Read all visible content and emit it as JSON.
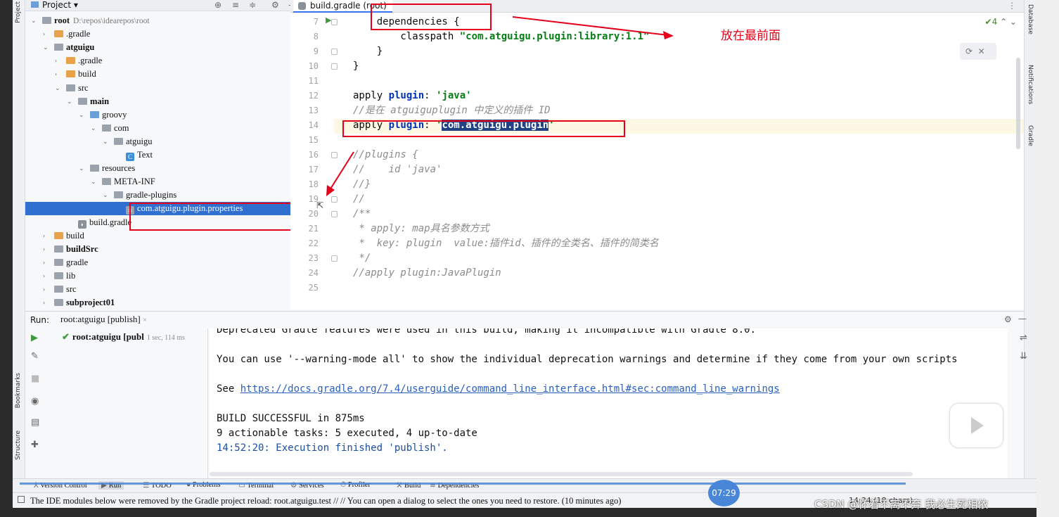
{
  "project": {
    "header_label": "Project",
    "tree": [
      {
        "label": "root",
        "path": "D:\\repos\\idearepos\\root",
        "depth": 0,
        "arrow": "down",
        "icon": "gray",
        "bold": true
      },
      {
        "label": ".gradle",
        "depth": 1,
        "arrow": "right",
        "icon": "orange"
      },
      {
        "label": "atguigu",
        "depth": 1,
        "arrow": "down",
        "icon": "gray",
        "bold": true
      },
      {
        "label": ".gradle",
        "depth": 2,
        "arrow": "right",
        "icon": "orange"
      },
      {
        "label": "build",
        "depth": 2,
        "arrow": "right",
        "icon": "orange"
      },
      {
        "label": "src",
        "depth": 2,
        "arrow": "down",
        "icon": "gray"
      },
      {
        "label": "main",
        "depth": 3,
        "arrow": "down",
        "icon": "gray",
        "bold": true
      },
      {
        "label": "groovy",
        "depth": 4,
        "arrow": "down",
        "icon": "blue"
      },
      {
        "label": "com",
        "depth": 5,
        "arrow": "down",
        "icon": "gray"
      },
      {
        "label": "atguigu",
        "depth": 6,
        "arrow": "down",
        "icon": "gray"
      },
      {
        "label": "Text",
        "depth": 7,
        "arrow": "",
        "icon": "class"
      },
      {
        "label": "resources",
        "depth": 4,
        "arrow": "down",
        "icon": "gray"
      },
      {
        "label": "META-INF",
        "depth": 5,
        "arrow": "down",
        "icon": "gray"
      },
      {
        "label": "gradle-plugins",
        "depth": 6,
        "arrow": "down",
        "icon": "gray"
      },
      {
        "label": "com.atguigu.plugin.properties",
        "depth": 7,
        "arrow": "",
        "icon": "props",
        "selected": true
      },
      {
        "label": "build.gradle",
        "depth": 3,
        "arrow": "",
        "icon": "gradle"
      },
      {
        "label": "build",
        "depth": 1,
        "arrow": "right",
        "icon": "orange"
      },
      {
        "label": "buildSrc",
        "depth": 1,
        "arrow": "right",
        "icon": "gray",
        "bold": true
      },
      {
        "label": "gradle",
        "depth": 1,
        "arrow": "right",
        "icon": "gray"
      },
      {
        "label": "lib",
        "depth": 1,
        "arrow": "right",
        "icon": "gray"
      },
      {
        "label": "src",
        "depth": 1,
        "arrow": "right",
        "icon": "gray"
      },
      {
        "label": "subproject01",
        "depth": 1,
        "arrow": "right",
        "icon": "gray",
        "bold": true
      }
    ]
  },
  "editor": {
    "tab_label": "build.gradle (root)",
    "indicator": "✔4",
    "annotation": "放在最前面",
    "lines": [
      {
        "n": "7",
        "html": "    <span class=\"cls\">dependencies</span> {"
      },
      {
        "n": "8",
        "html": "        classpath <span class=\"str\">\"com.atguigu.plugin:library:1.1\"</span>"
      },
      {
        "n": "9",
        "html": "    }"
      },
      {
        "n": "10",
        "html": "}"
      },
      {
        "n": "11",
        "html": ""
      },
      {
        "n": "12",
        "html": "apply <span class=\"kw\">plugin</span>: <span class=\"str\">'java'</span>"
      },
      {
        "n": "13",
        "html": "<span class=\"cm\">//是在 atguiguplugin 中定义的插件 ID</span>"
      },
      {
        "n": "14",
        "html": "apply <span class=\"kw\">plugin</span>: <span class=\"str\">'</span><span class=\"sel-txt\">com.atguigu.plugin</span><span class=\"str\">'</span>"
      },
      {
        "n": "15",
        "html": ""
      },
      {
        "n": "16",
        "html": "<span class=\"cm\">//plugins {</span>"
      },
      {
        "n": "17",
        "html": "<span class=\"cm\">//    id 'java'</span>"
      },
      {
        "n": "18",
        "html": "<span class=\"cm\">//}</span>"
      },
      {
        "n": "19",
        "html": "<span class=\"cm\">//</span>"
      },
      {
        "n": "20",
        "html": "<span class=\"cm\">/**</span>"
      },
      {
        "n": "21",
        "html": "<span class=\"cm\"> * apply: map具名参数方式</span>"
      },
      {
        "n": "22",
        "html": "<span class=\"cm\"> *  key: plugin  value:插件id、插件的全类名、插件的简类名</span>"
      },
      {
        "n": "23",
        "html": "<span class=\"cm\"> */</span>"
      },
      {
        "n": "24",
        "html": "<span class=\"cm\">//apply plugin:JavaPlugin</span>"
      },
      {
        "n": "25",
        "html": ""
      }
    ]
  },
  "run": {
    "label": "Run:",
    "tab": "root:atguigu [publish]",
    "tree_item": "root:atguigu [publ",
    "tree_time": "1 sec, 114 ms",
    "console": [
      {
        "text": "Deprecated Gradle features were used in this build, making it incompatible with Gradle 8.0.",
        "cls": ""
      },
      {
        "text": "",
        "cls": ""
      },
      {
        "text": "You can use '--warning-mode all' to show the individual deprecation warnings and determine if they come from your own scripts",
        "cls": ""
      },
      {
        "text": "",
        "cls": ""
      },
      {
        "text": "See ",
        "cls": "",
        "link": "https://docs.gradle.org/7.4/userguide/command_line_interface.html#sec:command_line_warnings"
      },
      {
        "text": "",
        "cls": ""
      },
      {
        "text": "BUILD SUCCESSFUL in 875ms",
        "cls": ""
      },
      {
        "text": "9 actionable tasks: 5 executed, 4 up-to-date",
        "cls": ""
      },
      {
        "text": "14:52:20: Execution finished 'publish'.",
        "cls": "blue"
      }
    ]
  },
  "tool_tabs": [
    "Version Control",
    "Run",
    "TODO",
    "Problems",
    "Terminal",
    "Services",
    "Profiler",
    "Build",
    "Dependencies"
  ],
  "side_labels": {
    "project": "Project",
    "bookmarks": "Bookmarks",
    "structure": "Structure",
    "database": "Database",
    "notifications": "Notifications",
    "gradle": "Gradle"
  },
  "status": {
    "message": "The IDE modules below were removed by the Gradle project reload: root.atguigu.test // // You can open a dialog to select the ones you need to restore. (10 minutes ago)",
    "position": "14:34 (18 chars)"
  },
  "overlay": {
    "time": "07:29",
    "watermark": "CSDN @怀着不离不弃 我必生死相依"
  }
}
